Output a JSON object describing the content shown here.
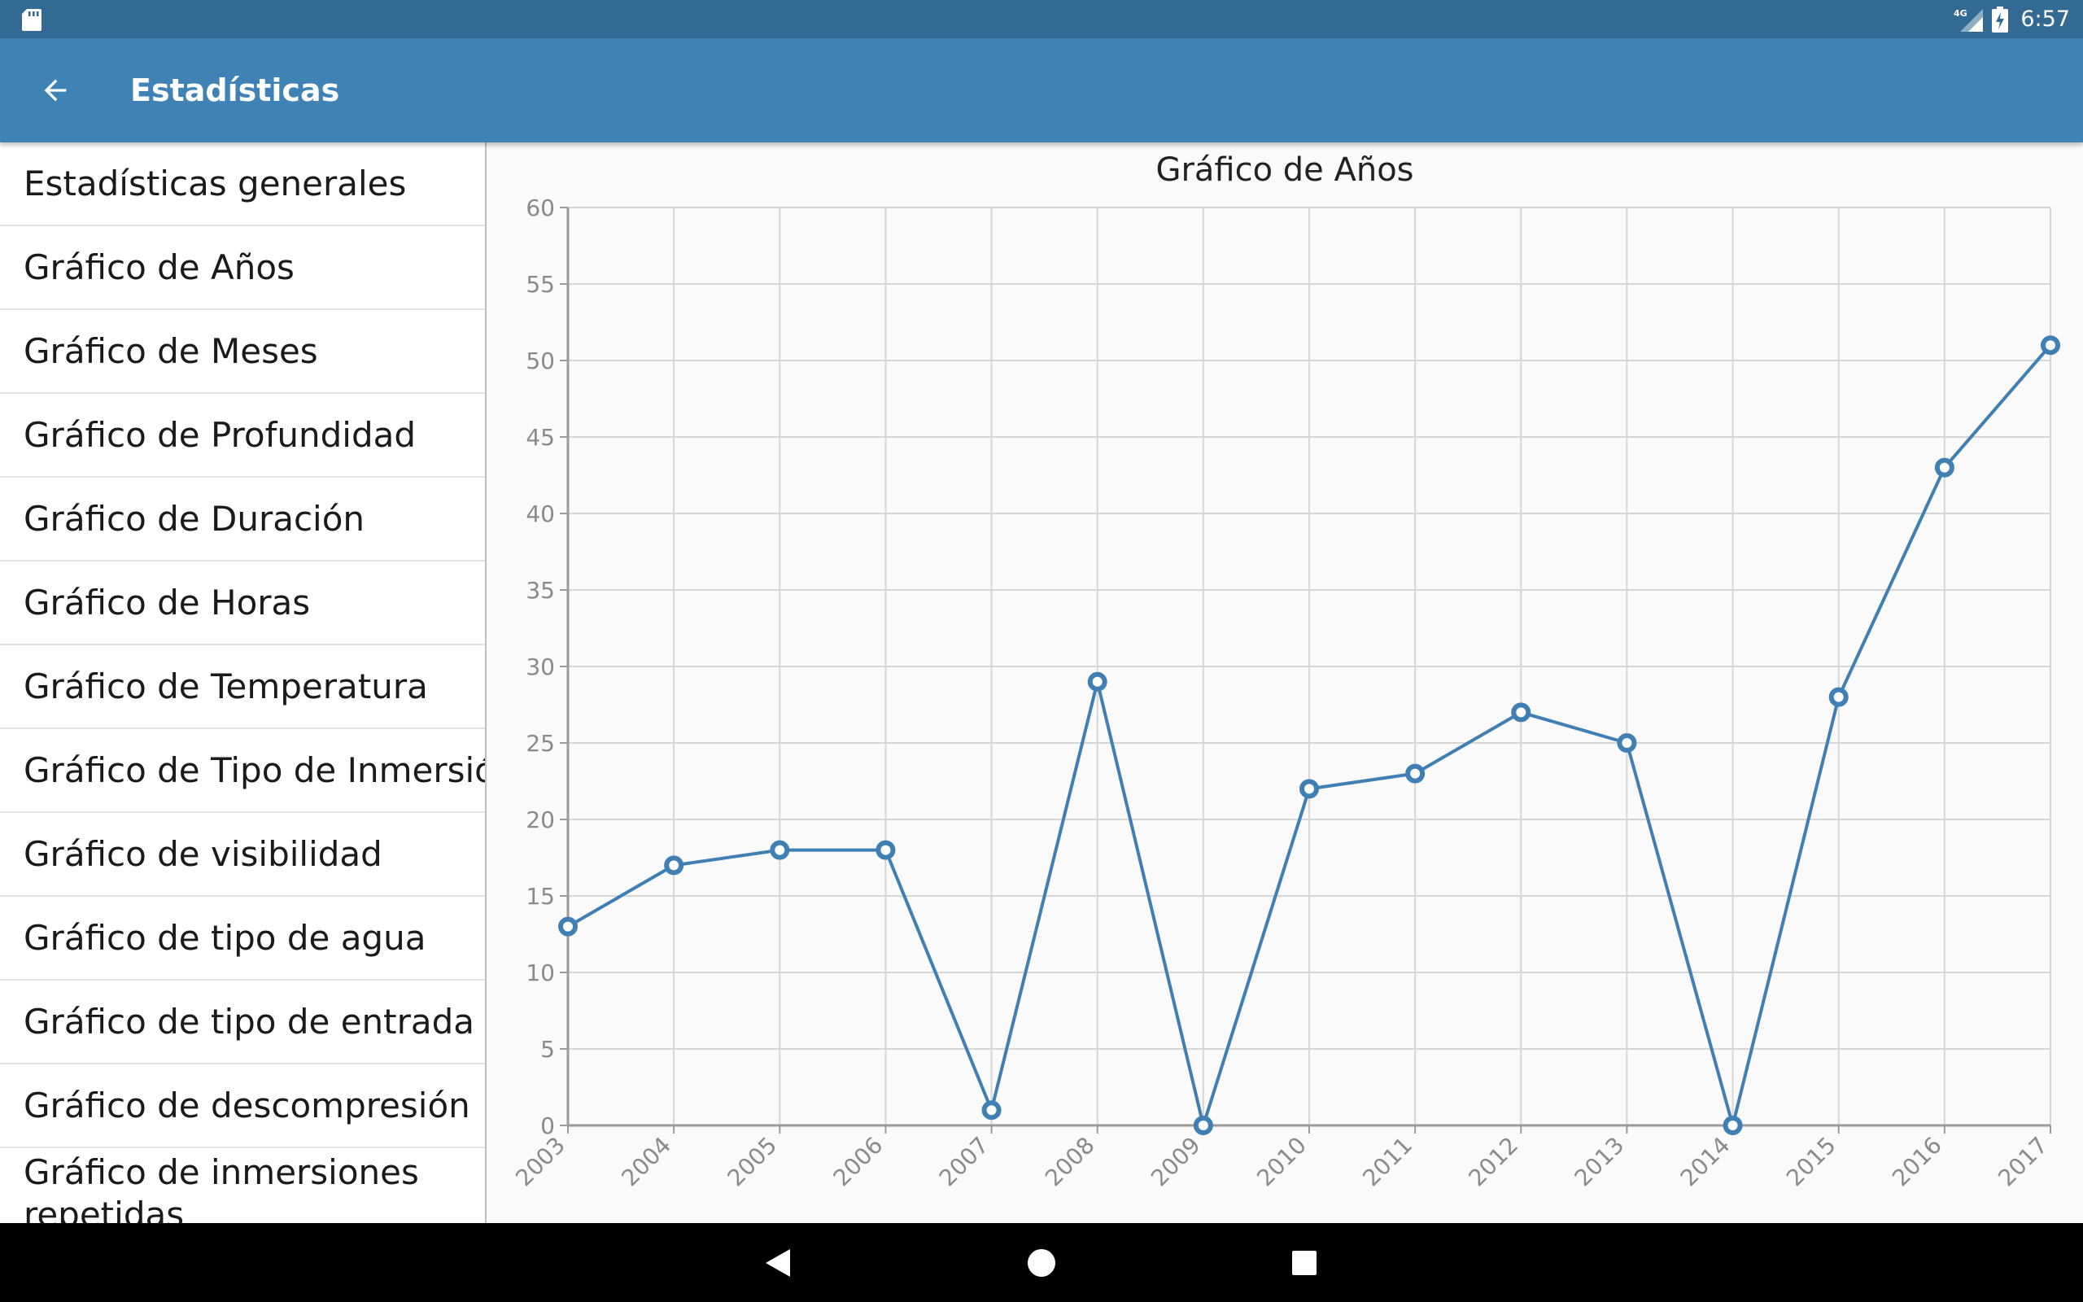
{
  "status_bar": {
    "time": "6:57",
    "network_label": "4G",
    "sd_icon": "sd-card-icon",
    "signal_icon": "signal-icon",
    "battery_icon": "battery-charging-icon"
  },
  "app_bar": {
    "title": "Estadísticas",
    "back_icon": "arrow-back-icon",
    "color": "#3f82b5",
    "status_color": "#336a93"
  },
  "sidebar": {
    "items": [
      {
        "label": "Estadísticas generales"
      },
      {
        "label": "Gráfico de Años"
      },
      {
        "label": "Gráfico de Meses"
      },
      {
        "label": "Gráfico de Profundidad"
      },
      {
        "label": "Gráfico de Duración"
      },
      {
        "label": "Gráfico de Horas"
      },
      {
        "label": "Gráfico de Temperatura"
      },
      {
        "label": "Gráfico de Tipo de Inmersión"
      },
      {
        "label": "Gráfico de visibilidad"
      },
      {
        "label": "Gráfico de tipo de agua"
      },
      {
        "label": "Gráfico de tipo de entrada"
      },
      {
        "label": "Gráfico de descompresión"
      },
      {
        "label": "Gráfico de inmersiones repetidas"
      }
    ]
  },
  "chart_data": {
    "type": "line",
    "title": "Gráfico de Años",
    "xlabel": "",
    "ylabel": "",
    "x": [
      "2003",
      "2004",
      "2005",
      "2006",
      "2007",
      "2008",
      "2009",
      "2010",
      "2011",
      "2012",
      "2013",
      "2014",
      "2015",
      "2016",
      "2017"
    ],
    "series": [
      {
        "values": [
          13,
          17,
          18,
          18,
          1,
          29,
          0,
          22,
          23,
          27,
          25,
          0,
          28,
          43,
          51
        ]
      }
    ],
    "ylim": [
      0,
      60
    ],
    "yticks": [
      0,
      5,
      10,
      15,
      20,
      25,
      30,
      35,
      40,
      45,
      50,
      55,
      60
    ],
    "grid": true,
    "line_color": "#3f7fb4",
    "grid_color": "#d6d6d6",
    "axis_color": "#9a9a9a"
  },
  "nav_bar": {
    "back_icon": "nav-back-icon",
    "home_icon": "nav-home-icon",
    "recents_icon": "nav-recents-icon"
  }
}
